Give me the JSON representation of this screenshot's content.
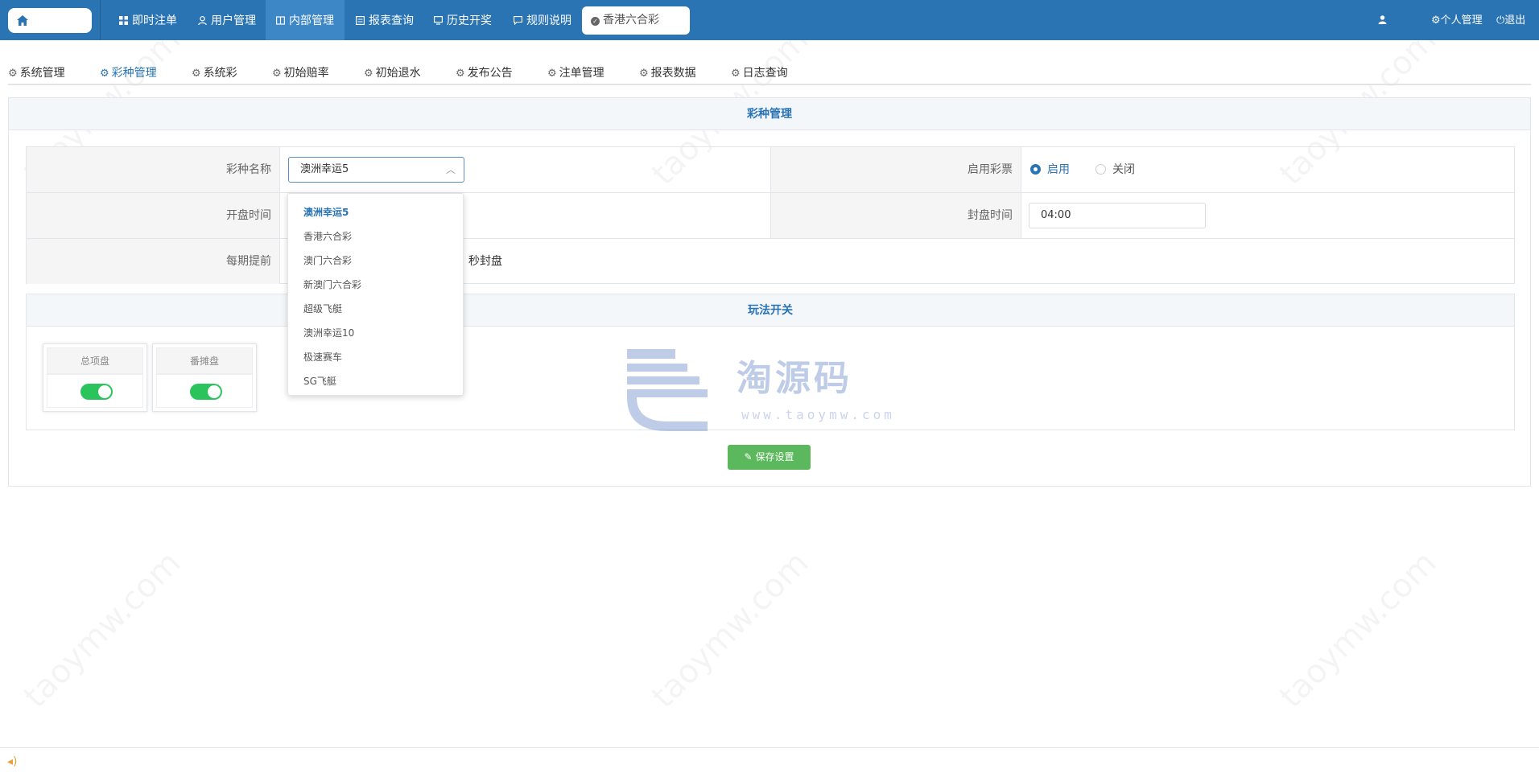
{
  "topbar": {
    "nav": [
      {
        "label": "即时注单",
        "icon": "grid-icon"
      },
      {
        "label": "用户管理",
        "icon": "user-icon"
      },
      {
        "label": "内部管理",
        "icon": "book-icon",
        "active": true
      },
      {
        "label": "报表查询",
        "icon": "report-icon"
      },
      {
        "label": "历史开奖",
        "icon": "monitor-icon"
      },
      {
        "label": "规则说明",
        "icon": "message-icon"
      }
    ],
    "current_lottery": "香港六合彩",
    "personal": "个人管理",
    "logout": "退出"
  },
  "subtabs": [
    {
      "label": "系统管理"
    },
    {
      "label": "彩种管理",
      "active": true
    },
    {
      "label": "系统彩"
    },
    {
      "label": "初始赔率"
    },
    {
      "label": "初始退水"
    },
    {
      "label": "发布公告"
    },
    {
      "label": "注单管理"
    },
    {
      "label": "报表数据"
    },
    {
      "label": "日志查询"
    }
  ],
  "panel": {
    "title": "彩种管理",
    "fields": {
      "lottery_name_label": "彩种名称",
      "lottery_name_value": "澳洲幸运5",
      "enable_label": "启用彩票",
      "enable_on": "启用",
      "enable_off": "关闭",
      "open_time_label": "开盘时间",
      "close_time_label": "封盘时间",
      "close_time_value": "04:00",
      "advance_label": "每期提前",
      "advance_suffix": "秒封盘"
    },
    "play_switch": {
      "title": "玩法开关",
      "cards": [
        {
          "label": "总项盘",
          "on": true
        },
        {
          "label": "番摊盘",
          "on": true
        }
      ]
    },
    "save_button": "保存设置"
  },
  "dropdown": {
    "options": [
      "澳洲幸运5",
      "香港六合彩",
      "澳门六合彩",
      "新澳门六合彩",
      "超级飞艇",
      "澳洲幸运10",
      "极速赛车",
      "SG飞艇"
    ],
    "selected_index": 0
  },
  "watermark": {
    "logo_text": "淘源码",
    "logo_url": "www.taoymw.com",
    "diagonal": "taoymw.com"
  },
  "colors": {
    "primary": "#2a74b3",
    "success": "#2bc45c",
    "save": "#5cb85c"
  }
}
